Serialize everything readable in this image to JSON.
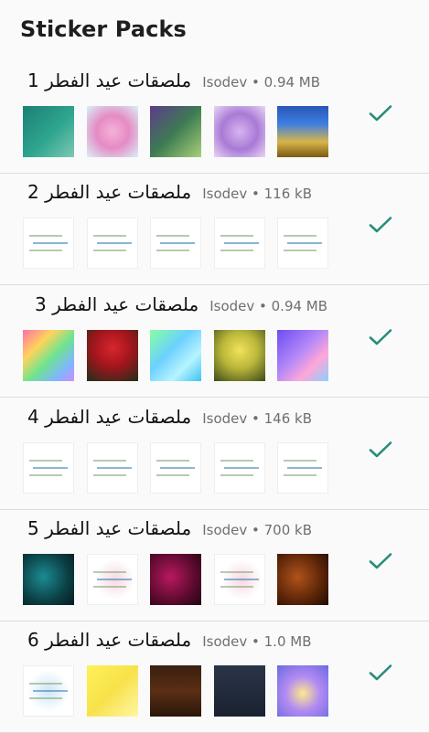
{
  "header": {
    "title": "Sticker Packs"
  },
  "colors": {
    "accent": "#2a8c7a",
    "divider": "#dcdcdc",
    "meta": "#6f6f6f"
  },
  "packs": [
    {
      "name": "ملصقات عيد الفطر 1",
      "meta": "Isodev • 0.94 MB",
      "stickers": [
        "teal-greeting-card",
        "pink-calligraphy-card",
        "green-purple-frame-card",
        "purple-calligraphy-card",
        "gold-mosque-card"
      ]
    },
    {
      "name": "ملصقات عيد الفطر 2",
      "meta": "Isodev • 116 kB",
      "stickers": [
        "white-text-card",
        "white-text-card",
        "white-text-card",
        "white-text-card",
        "white-text-card"
      ]
    },
    {
      "name": "ملصقات عيد الفطر 3",
      "meta": "Isodev • 0.94 MB",
      "stickers": [
        "rainbow-flower-card",
        "roses-eid-mubarak",
        "blue-flower-card",
        "yellow-roses-card",
        "purple-flower-card"
      ]
    },
    {
      "name": "ملصقات عيد الفطر 4",
      "meta": "Isodev • 146 kB",
      "stickers": [
        "white-text-card",
        "white-text-card",
        "white-text-card",
        "white-text-card",
        "white-text-card"
      ]
    },
    {
      "name": "ملصقات عيد الفطر 5",
      "meta": "Isodev • 700 kB",
      "stickers": [
        "teal-ornament-card",
        "white-calligraphy-card",
        "magenta-ornament-card",
        "white-calligraphy-card",
        "orange-ornament-card"
      ]
    },
    {
      "name": "ملصقات عيد الفطر 6",
      "meta": "Isodev • 1.0 MB",
      "stickers": [
        "blue-calligraphy-card",
        "yellow-calligraphy-card",
        "brown-eid-mubarak-card",
        "dark-eid-saeed-card",
        "purple-floral-card"
      ]
    }
  ]
}
